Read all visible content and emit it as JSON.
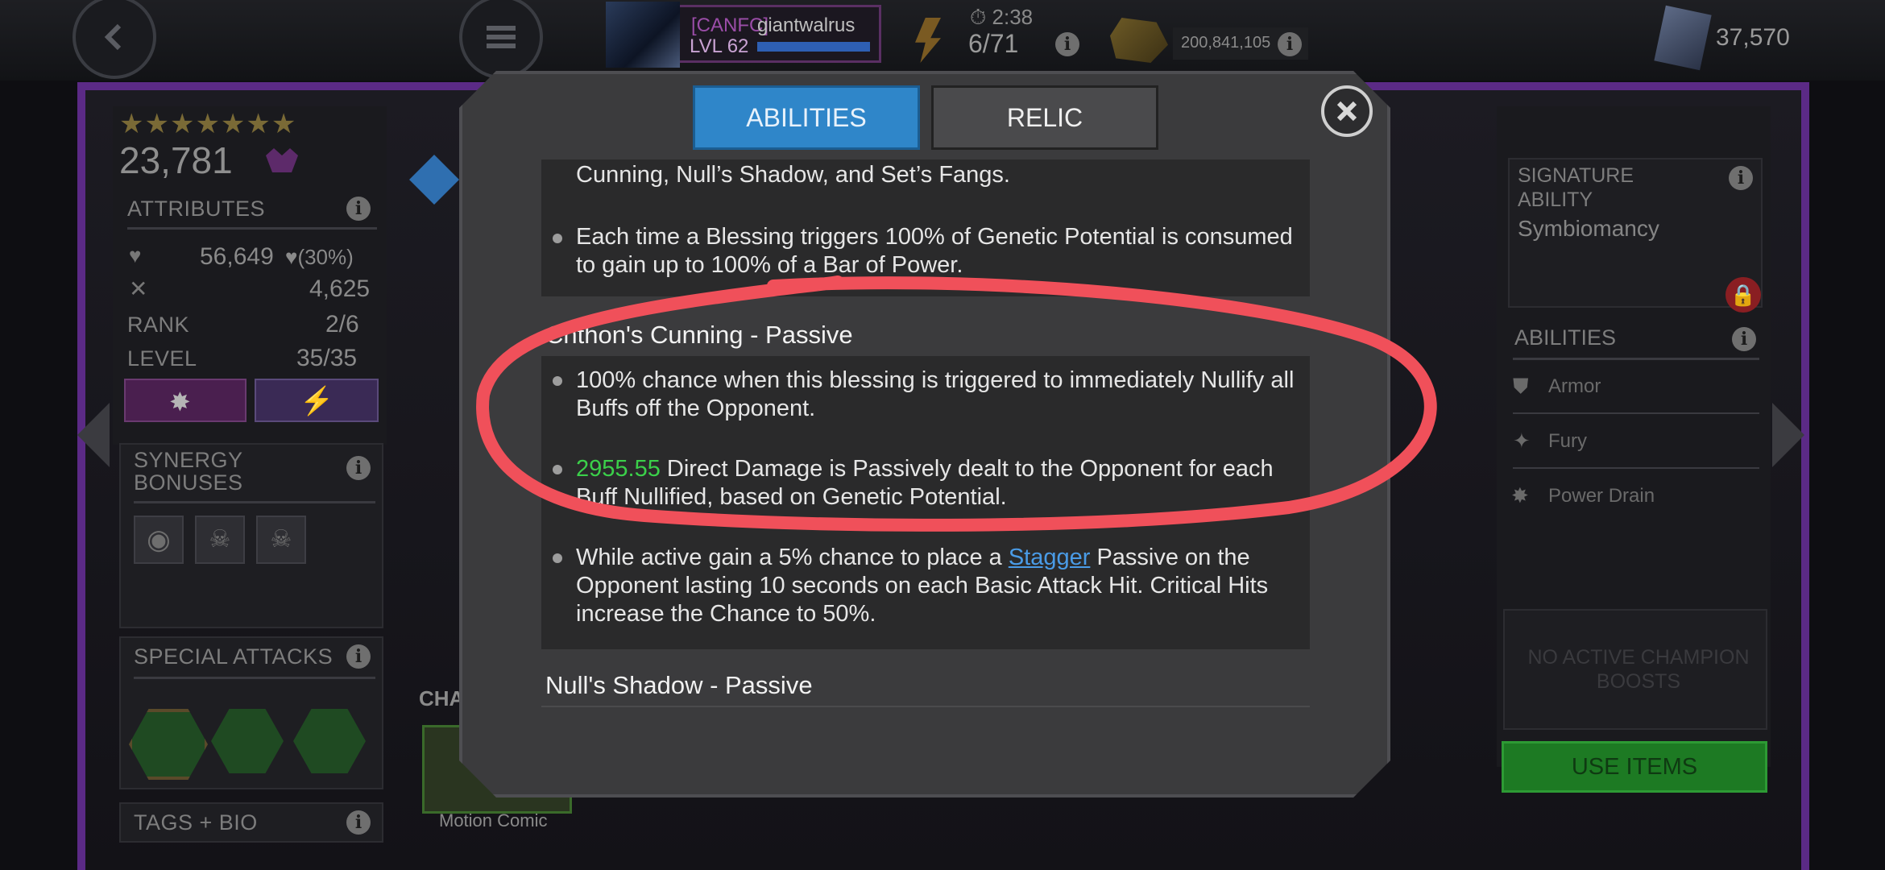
{
  "topbar": {
    "player_tag": "[CANFC]",
    "player_name": "giantwalrus",
    "player_level": "LVL 62",
    "timer": "2:38",
    "energy": "6/71",
    "gold": "200,841,105",
    "units": "37,570"
  },
  "champion": {
    "stars": "★★★★★★★",
    "rating": "23,781",
    "attributes_label": "ATTRIBUTES",
    "health": "56,649",
    "health_pct": "(30%)",
    "attack": "4,625",
    "rank_label": "RANK",
    "rank_value": "2/6",
    "level_label": "LEVEL",
    "level_value": "35/35",
    "synergy_label_1": "SYNERGY",
    "synergy_label_2": "BONUSES",
    "special_attacks_label": "SPECIAL ATTACKS",
    "tags_label": "TAGS + BIO",
    "cha_label": "CHA",
    "motion_comic_label": "Motion Comic"
  },
  "right_panel": {
    "signature_label_1": "SIGNATURE",
    "signature_label_2": "ABILITY",
    "signature_name": "Symbiomancy",
    "abilities_label": "ABILITIES",
    "abilities": [
      "Armor",
      "Fury",
      "Power Drain"
    ],
    "boosts_line_1": "NO ACTIVE CHAMPION",
    "boosts_line_2": "BOOSTS",
    "use_items_label": "USE ITEMS"
  },
  "modal": {
    "tab_abilities": "ABILITIES",
    "tab_relic": "RELIC",
    "top_block": {
      "line_fragment": "Cunning, Null’s Shadow, and Set’s Fangs.",
      "bullet_1_line_1": "Each time a Blessing triggers 100% of Genetic Potential is consumed",
      "bullet_1_line_2": "to gain up to 100% of a Bar of Power."
    },
    "section_1_title": "Chthon's Cunning - Passive",
    "section_1": {
      "bullet_1_line_1": "100% chance when this blessing is triggered to immediately Nullify all",
      "bullet_1_line_2": "Buffs off the Opponent.",
      "bullet_2_value": "2955.55",
      "bullet_2_line_1_rest": " Direct Damage is Passively dealt to the Opponent for each",
      "bullet_2_line_2": "Buff Nullified, based on Genetic Potential.",
      "bullet_3_line_1_pre": "While active gain a 5% chance to place a ",
      "bullet_3_link": "Stagger",
      "bullet_3_line_1_post": " Passive on the",
      "bullet_3_line_2": "Opponent lasting 10 seconds on each Basic Attack Hit. Critical Hits",
      "bullet_3_line_3": "increase the Chance to 50%."
    },
    "section_2_title": "Null's Shadow - Passive"
  },
  "colors": {
    "accent_blue": "#2f86c9",
    "frame_purple": "#5b2a86",
    "highlight_green": "#3bd04a",
    "annotation_red": "#f0505a",
    "use_items_green": "#1d7a23"
  }
}
